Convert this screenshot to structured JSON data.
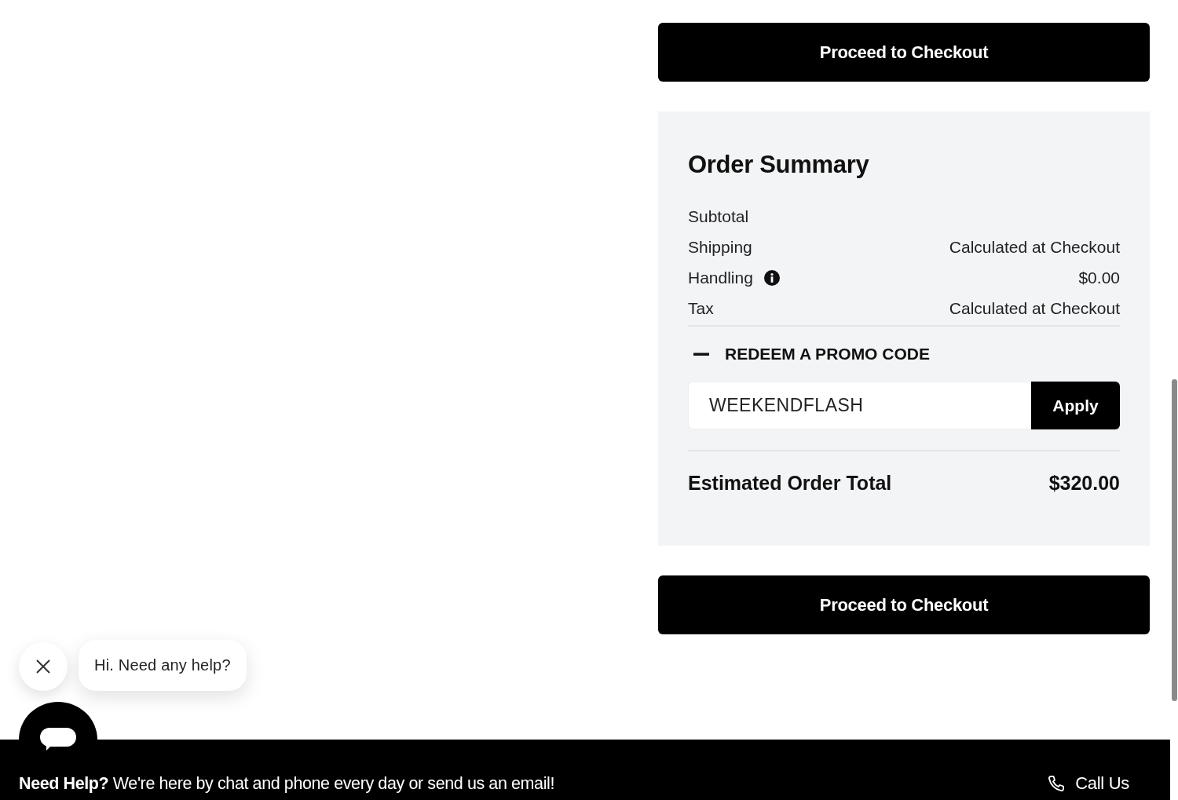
{
  "top_button": {
    "label": "Proceed to Checkout"
  },
  "summary": {
    "title": "Order Summary",
    "rows": [
      {
        "label": "Subtotal",
        "info": false
      },
      {
        "label": "Shipping",
        "value": "Calculated at Checkout",
        "info": false
      },
      {
        "label": "Handling",
        "value": "$0.00",
        "info": true
      },
      {
        "label": "Tax",
        "value": "Calculated at Checkout",
        "info": false
      }
    ],
    "promo": {
      "title": "REDEEM A PROMO CODE",
      "expanded": true,
      "value": "WEEKENDFLASH",
      "button": "Apply"
    },
    "total": {
      "label": "Estimated Order Total",
      "value": "$320.00"
    }
  },
  "bottom_button": {
    "label": "Proceed to Checkout"
  },
  "chat": {
    "message": "Hi. Need any help?"
  },
  "help_bar": {
    "text": "**Need Help?** We're here by chat and phone every day or send us an email!",
    "call": "Call Us"
  }
}
